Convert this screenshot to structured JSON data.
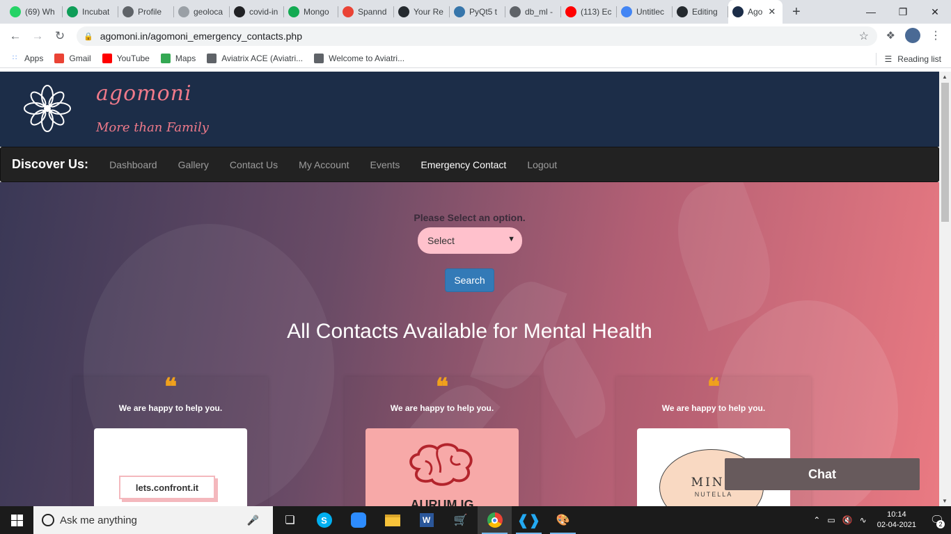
{
  "browser": {
    "tabs": [
      {
        "title": "(69) Wh",
        "color": "#25d366"
      },
      {
        "title": "Incubat",
        "color": "#0f9d58"
      },
      {
        "title": "Profile",
        "color": "#5f6368"
      },
      {
        "title": "geoloca",
        "color": "#9aa0a6"
      },
      {
        "title": "covid-in",
        "color": "#202124"
      },
      {
        "title": "Mongo",
        "color": "#13aa52"
      },
      {
        "title": "Spannd",
        "color": "#ea4335"
      },
      {
        "title": "Your Re",
        "color": "#24292e"
      },
      {
        "title": "PyQt5 t",
        "color": "#3776ab"
      },
      {
        "title": "db_ml -",
        "color": "#5f6368"
      },
      {
        "title": "(113) Ec",
        "color": "#ff0000"
      },
      {
        "title": "Untitlec",
        "color": "#4285f4"
      },
      {
        "title": "Editing",
        "color": "#24292e"
      },
      {
        "title": "Ago",
        "color": "#1c2d48"
      }
    ],
    "url": "agomoni.in/agomoni_emergency_contacts.php",
    "bookmarks": [
      {
        "label": "Apps",
        "color": "#4285f4"
      },
      {
        "label": "Gmail",
        "color": "#ea4335"
      },
      {
        "label": "YouTube",
        "color": "#ff0000"
      },
      {
        "label": "Maps",
        "color": "#34a853"
      },
      {
        "label": "Aviatrix ACE (Aviatri...",
        "color": "#5f6368"
      },
      {
        "label": "Welcome to Aviatri...",
        "color": "#5f6368"
      }
    ],
    "reading_list": "Reading list"
  },
  "site": {
    "brand_name": "agomoni",
    "brand_tagline": "More than Family",
    "nav_brand": "Discover Us:",
    "nav": [
      "Dashboard",
      "Gallery",
      "Contact Us",
      "My Account",
      "Events",
      "Emergency Contact",
      "Logout"
    ],
    "active_nav": "Emergency Contact",
    "select_label": "Please Select an option.",
    "select_value": "Select",
    "search_button": "Search",
    "section_title": "All Contacts Available for Mental Health",
    "cards": [
      {
        "quote": "❝",
        "text": "We are happy to help you.",
        "image_text": "lets.confront.it",
        "image_bg": "#ffffff"
      },
      {
        "quote": "❝",
        "text": "We are happy to help you.",
        "image_text": "AURUM IG",
        "image_bg": "#f7a9a8"
      },
      {
        "quote": "❝",
        "text": "We are happy to help you.",
        "image_text": "MIND",
        "image_subtext": "NUTELLA",
        "image_bg": "#ffffff"
      }
    ],
    "chat_button": "Chat"
  },
  "taskbar": {
    "search_placeholder": "Ask me anything",
    "time": "10:14",
    "date": "02-04-2021",
    "notifications": "2"
  }
}
